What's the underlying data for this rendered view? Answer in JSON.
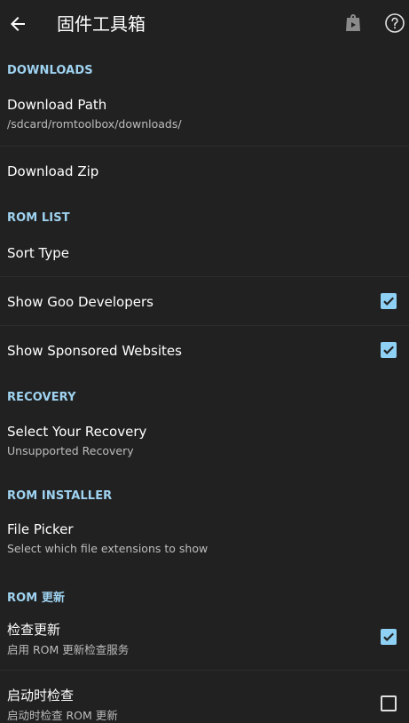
{
  "toolbar": {
    "title": "固件工具箱",
    "icons": [
      "back-arrow-icon",
      "store-bag-icon",
      "help-circle-icon"
    ]
  },
  "sections": {
    "downloads": "DOWNLOADS",
    "rom_list": "ROM LIST",
    "recovery": "RECOVERY",
    "rom_installer": "ROM INSTALLER",
    "rom_update": "ROM 更新"
  },
  "prefs": {
    "download_path": {
      "title": "Download Path",
      "summary": "/sdcard/romtoolbox/downloads/"
    },
    "download_zip": {
      "title": "Download Zip"
    },
    "sort_type": {
      "title": "Sort Type"
    },
    "show_goo": {
      "title": "Show Goo Developers",
      "checked": true
    },
    "show_sponsored": {
      "title": "Show Sponsored Websites",
      "checked": true
    },
    "select_recovery": {
      "title": "Select Your Recovery",
      "summary": "Unsupported Recovery"
    },
    "file_picker": {
      "title": "File Picker",
      "summary": "Select which file extensions to show"
    },
    "check_update": {
      "title": "检查更新",
      "summary": "启用 ROM 更新检查服务",
      "checked": true
    },
    "check_on_start": {
      "title": "启动时检查",
      "summary": "启动时检查 ROM 更新",
      "checked": false
    }
  },
  "colors": {
    "background": "#212121",
    "accent": "#8fd0f5",
    "section_header": "#9fd3f1",
    "summary_text": "#bdbdbd"
  }
}
